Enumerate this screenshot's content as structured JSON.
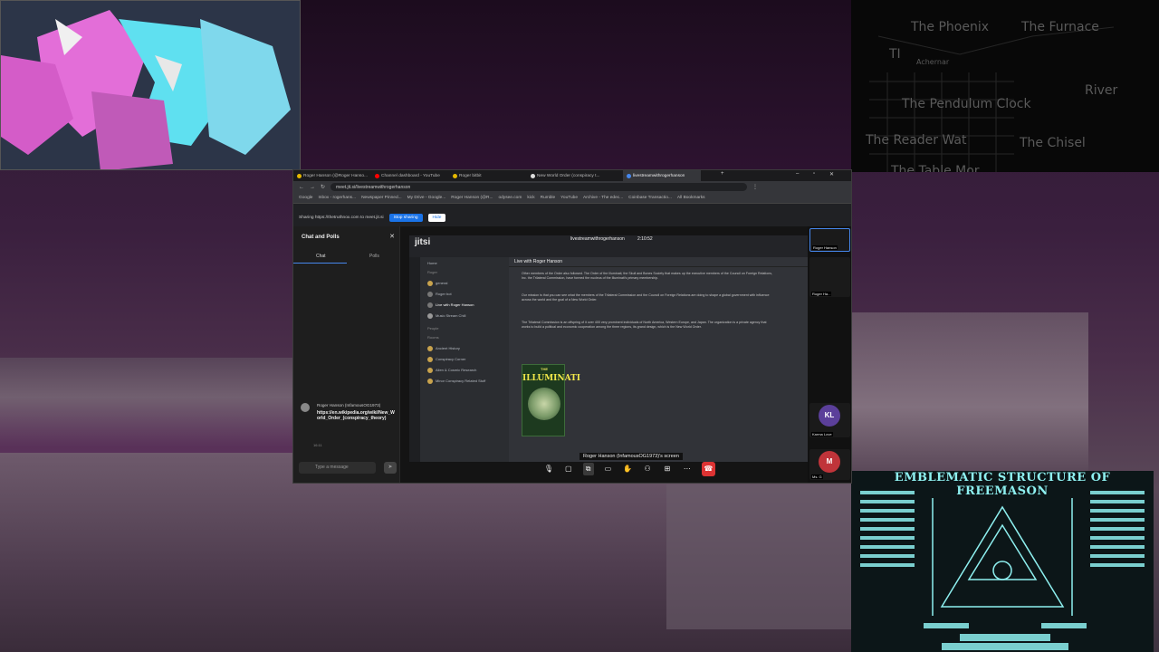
{
  "sky_panel": {
    "labels": [
      "The Furnace",
      "The Phoenix",
      "Achernar",
      "TI",
      "River",
      "The Pendulum Clock",
      "The Chisel",
      "The Reader Wat",
      "The Table Mor"
    ]
  },
  "chart_panel": {
    "title": "EMBLEMATIC STRUCTURE OF FREEMASON"
  },
  "browser": {
    "tabs": [
      {
        "label": "Roger Hanson (@Roger Hanso...",
        "color": "#e6b800"
      },
      {
        "label": "Channel dashboard - YouTube",
        "color": "#ff0000"
      },
      {
        "label": "Roger bitbit",
        "color": "#e6b800"
      },
      {
        "label": "New World Order (conspiracy t...",
        "color": "#dddddd"
      },
      {
        "label": "livestreamwithrogerhanson",
        "color": "#4687ed"
      }
    ],
    "url": "meet.jit.si/livestreamwithrogerhanson",
    "bookmarks": [
      "Google",
      "Inbox - rogerhans...",
      "Newspaper Pinned...",
      "My Drive - Google...",
      "Roger Hanson (@R...",
      "odysee.com",
      "kick",
      "Rumble",
      "YouTube",
      "Archive - The edec...",
      "Coinbase Transactio...",
      "All Bookmarks"
    ],
    "share_text": "Sharing https://thetruthnox.com to meet.jit.si",
    "stop_sharing": "Stop sharing",
    "hide": "Hide"
  },
  "chat": {
    "title": "Chat and Polls",
    "tab_chat": "Chat",
    "tab_polls": "Polls",
    "message_sender": "Roger Hanson (InfamousOG1973)",
    "message_link": "https://en.wikipedia.org/wiki/New_World_Order_(conspiracy_theory)",
    "message_time": "16:11",
    "input_placeholder": "Type a message",
    "send_icon": "send-icon"
  },
  "shared": {
    "logo": "jitsi",
    "meeting_title": "livestreamwithrogerhanson",
    "timer": "2:10:52",
    "channels": [
      "Home",
      "Roger",
      "general",
      "Roger bot",
      "Live with Roger Hanson",
      "Music Stream Chill",
      "People",
      "Rooms",
      "Ancient History",
      "Conspiracy Corner",
      "Alien & Cosmic Research",
      "Minor Conspiracy Related Stuff"
    ],
    "main_header": "Live with Roger Hanson",
    "paragraphs": [
      "Other members of the Order also followed. The Order of the Illuminati, the Skull and Bones Society that makes up the executive members of the Council on Foreign Relations, Inc. the Trilateral Commission, have formed the nucleus of the Illuminati's primary membership.",
      "Our mission is that you can see what the members of the Trilateral Commission and the Council on Foreign Relations are doing to shape a global government with influence across the world and the goal of a New World Order.",
      "The Trilateral Commission is an offspring of it over 400 very prominent individuals of North America, Western Europe, and Japan. The organization is a private agency that works to build a political and economic cooperation among the three regions, its grand design, which is the New World Order."
    ],
    "poster_top": "THE",
    "poster_title": "ILLUMINATI",
    "screen_label": "Roger Hanson (InfamousOG1973)'s screen"
  },
  "thumbs": [
    {
      "name": "Roger Hanson"
    },
    {
      "name": "Roger Ha..."
    },
    {
      "initials": "KL",
      "name": "Karma Love",
      "color": "#5b3f9a"
    },
    {
      "initials": "M",
      "name": "Ms. G",
      "color": "#c0343a"
    }
  ],
  "toolbar": {
    "icons": [
      "microphone-icon",
      "camera-icon",
      "screenshare-icon",
      "chat-icon",
      "raise-hand-icon",
      "participants-icon",
      "tile-view-icon",
      "more-icon",
      "hangup-icon"
    ]
  }
}
